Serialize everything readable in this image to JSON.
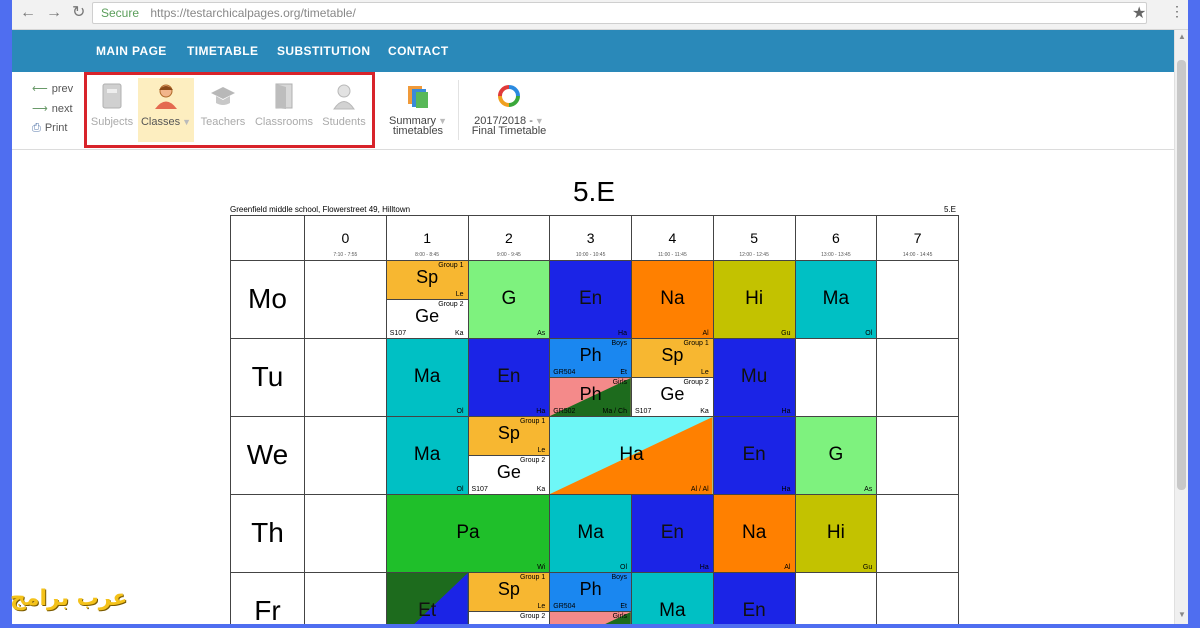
{
  "browser": {
    "secure_label": "Secure",
    "url": "https://testarchicalpages.org/timetable/"
  },
  "nav": {
    "items": [
      "MAIN PAGE",
      "TIMETABLE",
      "SUBSTITUTION",
      "CONTACT"
    ]
  },
  "toolbar": {
    "prev": "prev",
    "next": "next",
    "print": "Print",
    "views": [
      {
        "label": "Subjects",
        "active": false
      },
      {
        "label": "Classes",
        "active": true
      },
      {
        "label": "Teachers",
        "active": false
      },
      {
        "label": "Classrooms",
        "active": false
      },
      {
        "label": "Students",
        "active": false
      }
    ],
    "summary_line1": "Summary",
    "summary_line2": "timetables",
    "term_line1": "2017/2018 -",
    "term_line2": "Final Timetable"
  },
  "timetable": {
    "title": "5.E",
    "school": "Greenfield middle school, Flowerstreet 49, Hilltown",
    "class_label": "5.E",
    "periods": [
      {
        "num": "0",
        "time": "7:10 - 7:55"
      },
      {
        "num": "1",
        "time": "8:00 - 8:45"
      },
      {
        "num": "2",
        "time": "9:00 - 9:45"
      },
      {
        "num": "3",
        "time": "10:00 - 10:45"
      },
      {
        "num": "4",
        "time": "11:00 - 11:45"
      },
      {
        "num": "5",
        "time": "12:00 - 12:45"
      },
      {
        "num": "6",
        "time": "13:00 - 13:45"
      },
      {
        "num": "7",
        "time": "14:00 - 14:45"
      }
    ],
    "days": [
      "Mo",
      "Tu",
      "We",
      "Th",
      "Fr"
    ],
    "lessons": [
      {
        "day": 0,
        "p": 1,
        "span": 1,
        "part": "top",
        "subj": "Sp",
        "color": "#f7b731",
        "tr": "Group 1",
        "br": "Le"
      },
      {
        "day": 0,
        "p": 1,
        "span": 1,
        "part": "bottom",
        "subj": "Ge",
        "color": "#ffffff",
        "tr": "Group 2",
        "bl": "S107",
        "br": "Ka"
      },
      {
        "day": 0,
        "p": 2,
        "span": 1,
        "subj": "G",
        "color": "#7ef27e",
        "br": "As"
      },
      {
        "day": 0,
        "p": 3,
        "span": 1,
        "subj": "En",
        "color": "#1b24e6",
        "br": "Ha"
      },
      {
        "day": 0,
        "p": 4,
        "span": 1,
        "subj": "Na",
        "color": "#ff8000",
        "br": "Al"
      },
      {
        "day": 0,
        "p": 5,
        "span": 1,
        "subj": "Hi",
        "color": "#c3c200",
        "br": "Gu"
      },
      {
        "day": 0,
        "p": 6,
        "span": 1,
        "subj": "Ma",
        "color": "#00c0c4",
        "br": "Ol"
      },
      {
        "day": 1,
        "p": 1,
        "span": 1,
        "subj": "Ma",
        "color": "#00c0c4",
        "br": "Ol"
      },
      {
        "day": 1,
        "p": 2,
        "span": 1,
        "subj": "En",
        "color": "#1b24e6",
        "br": "Ha"
      },
      {
        "day": 1,
        "p": 3,
        "span": 1,
        "part": "top",
        "subj": "Ph",
        "color": "#1a87f0",
        "tr": "Boys",
        "bl": "GR504",
        "br": "Et"
      },
      {
        "day": 1,
        "p": 3,
        "span": 1,
        "part": "bottom",
        "subj": "Ph",
        "color": "#f48a8a",
        "color2": "#1d6b1d",
        "tr": "Girls",
        "bl": "GR502",
        "br": "Ma / Ch"
      },
      {
        "day": 1,
        "p": 4,
        "span": 1,
        "part": "top",
        "subj": "Sp",
        "color": "#f7b731",
        "tr": "Group 1",
        "br": "Le"
      },
      {
        "day": 1,
        "p": 4,
        "span": 1,
        "part": "bottom",
        "subj": "Ge",
        "color": "#ffffff",
        "tr": "Group 2",
        "bl": "S107",
        "br": "Ka"
      },
      {
        "day": 1,
        "p": 5,
        "span": 1,
        "subj": "Mu",
        "color": "#1b24e6",
        "br": "Ha"
      },
      {
        "day": 2,
        "p": 1,
        "span": 1,
        "subj": "Ma",
        "color": "#00c0c4",
        "br": "Ol"
      },
      {
        "day": 2,
        "p": 2,
        "span": 1,
        "part": "top",
        "subj": "Sp",
        "color": "#f7b731",
        "tr": "Group 1",
        "br": "Le"
      },
      {
        "day": 2,
        "p": 2,
        "span": 1,
        "part": "bottom",
        "subj": "Ge",
        "color": "#ffffff",
        "tr": "Group 2",
        "bl": "S107",
        "br": "Ka"
      },
      {
        "day": 2,
        "p": 3,
        "span": 2,
        "subj": "Ha",
        "color": "#6ef7f7",
        "color2": "#ff8000",
        "br": "Al / Al"
      },
      {
        "day": 2,
        "p": 5,
        "span": 1,
        "subj": "En",
        "color": "#1b24e6",
        "br": "Ha"
      },
      {
        "day": 2,
        "p": 6,
        "span": 1,
        "subj": "G",
        "color": "#7ef27e",
        "br": "As"
      },
      {
        "day": 3,
        "p": 1,
        "span": 2,
        "subj": "Pa",
        "color": "#1fbf2a",
        "br": "Wi"
      },
      {
        "day": 3,
        "p": 3,
        "span": 1,
        "subj": "Ma",
        "color": "#00c0c4",
        "br": "Ol"
      },
      {
        "day": 3,
        "p": 4,
        "span": 1,
        "subj": "En",
        "color": "#1b24e6",
        "br": "Ha"
      },
      {
        "day": 3,
        "p": 5,
        "span": 1,
        "subj": "Na",
        "color": "#ff8000",
        "br": "Al"
      },
      {
        "day": 3,
        "p": 6,
        "span": 1,
        "subj": "Hi",
        "color": "#c3c200",
        "br": "Gu"
      },
      {
        "day": 4,
        "p": 1,
        "span": 1,
        "subj": "Et",
        "color": "#1d6b1d",
        "color2": "#1b24e6"
      },
      {
        "day": 4,
        "p": 2,
        "span": 1,
        "part": "top",
        "subj": "Sp",
        "color": "#f7b731",
        "tr": "Group 1",
        "br": "Le"
      },
      {
        "day": 4,
        "p": 2,
        "span": 1,
        "part": "bottom",
        "subj": "",
        "color": "#ffffff",
        "tr": "Group 2"
      },
      {
        "day": 4,
        "p": 3,
        "span": 1,
        "part": "top",
        "subj": "Ph",
        "color": "#1a87f0",
        "tr": "Boys",
        "bl": "GR504",
        "br": "Et"
      },
      {
        "day": 4,
        "p": 3,
        "span": 1,
        "part": "bottom",
        "subj": "",
        "color": "#f48a8a",
        "color2": "#1d6b1d",
        "tr": "Girls"
      },
      {
        "day": 4,
        "p": 4,
        "span": 1,
        "subj": "Ma",
        "color": "#00c0c4"
      },
      {
        "day": 4,
        "p": 5,
        "span": 1,
        "subj": "En",
        "color": "#1b24e6"
      }
    ]
  },
  "watermark": "عرب برامج"
}
